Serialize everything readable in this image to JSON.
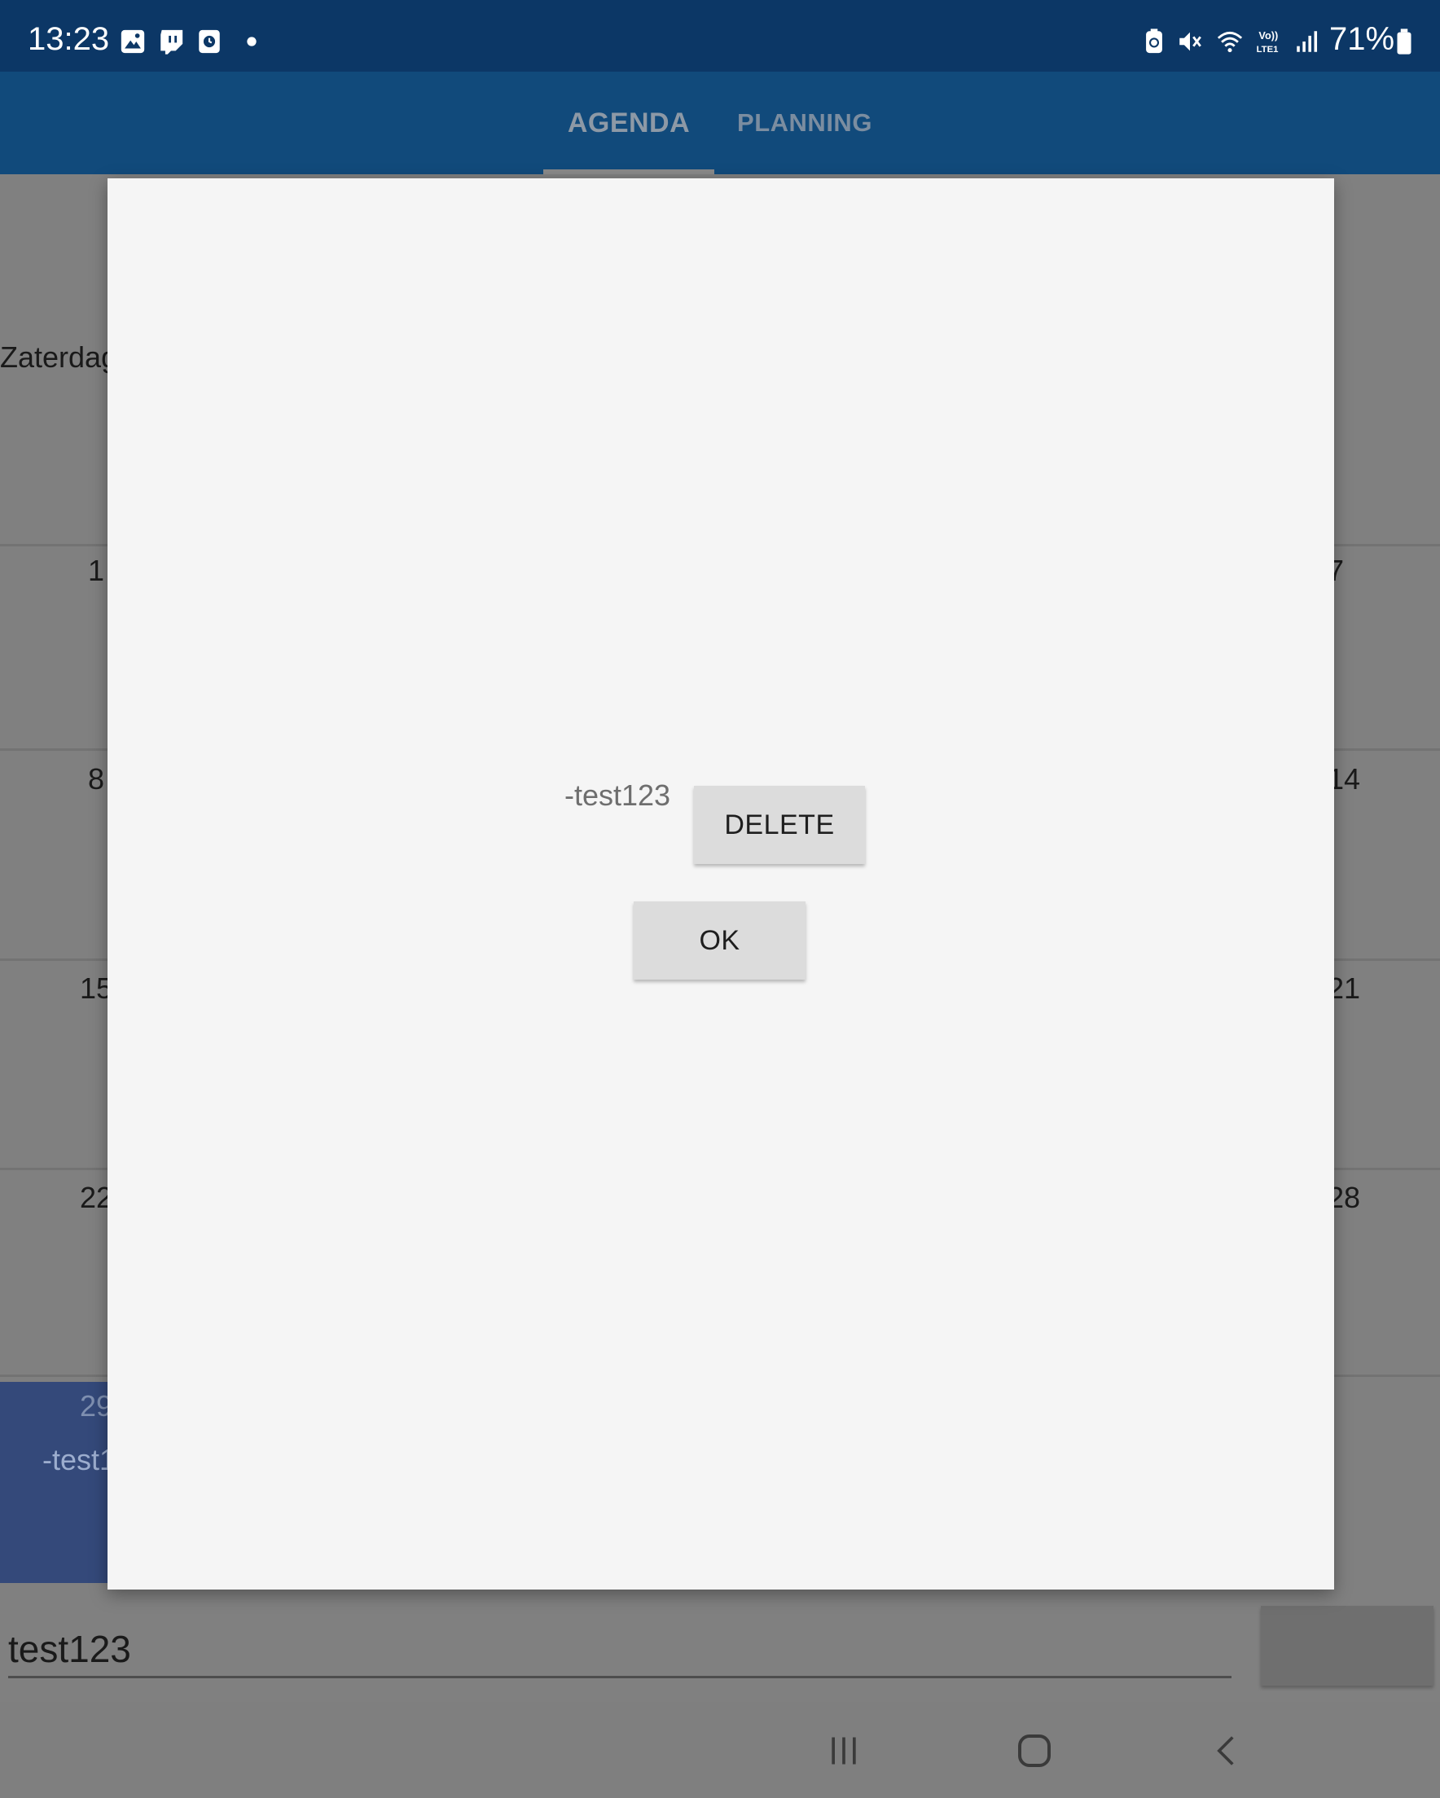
{
  "status_bar": {
    "time": "13:23",
    "battery": "71%"
  },
  "tabs": [
    {
      "label": "AGENDA"
    },
    {
      "label": "PLANNING"
    }
  ],
  "calendar": {
    "header_left": "Zaterdag",
    "left_days": [
      "1",
      "8",
      "15",
      "22"
    ],
    "right_days": [
      "7",
      "14",
      "21",
      "28"
    ],
    "highlight": {
      "day": "29",
      "event": "-test1"
    }
  },
  "input": {
    "value": "test123"
  },
  "dialog": {
    "event_text": "-test123",
    "delete_label": "DELETE",
    "ok_label": "OK"
  },
  "colors": {
    "status_bar": "#0c3766",
    "tab_bar": "#114a7b",
    "dialog_bg": "#f5f5f5",
    "button_bg": "#dcdcdc",
    "highlight": "#34497a"
  }
}
